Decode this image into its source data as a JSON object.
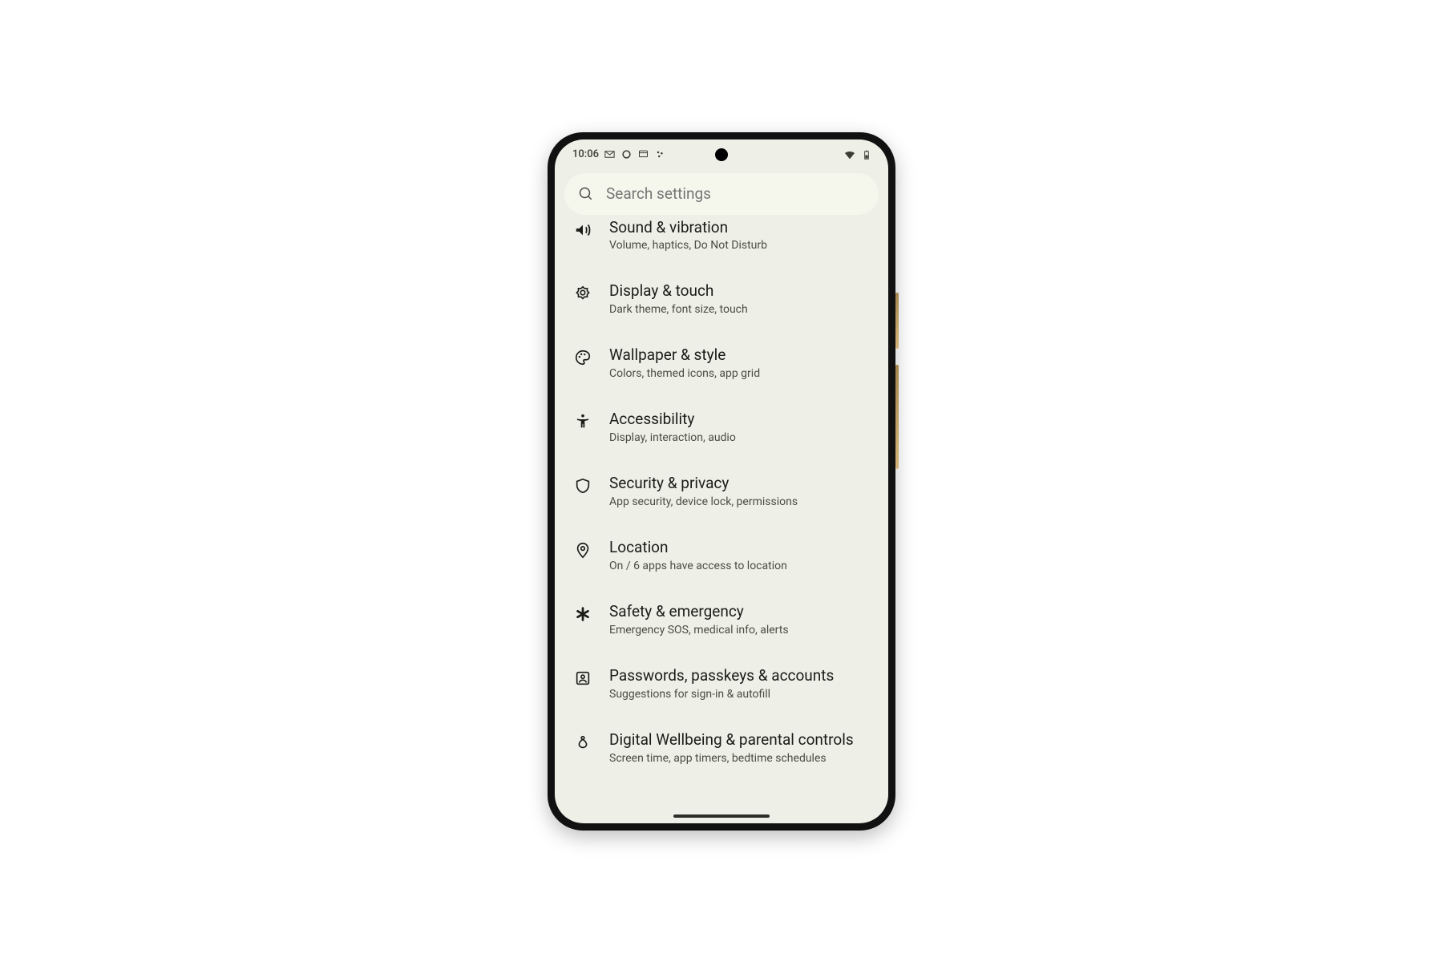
{
  "status": {
    "time": "10:06",
    "left_icons": [
      "gmail",
      "circle",
      "chat",
      "dots"
    ],
    "right_icons": [
      "wifi",
      "battery"
    ]
  },
  "search": {
    "placeholder": "Search settings"
  },
  "settings": [
    {
      "id": "sound",
      "icon": "volume-icon",
      "title": "Sound & vibration",
      "subtitle": "Volume, haptics, Do Not Disturb"
    },
    {
      "id": "display",
      "icon": "brightness-icon",
      "title": "Display & touch",
      "subtitle": "Dark theme, font size, touch"
    },
    {
      "id": "wallpaper",
      "icon": "palette-icon",
      "title": "Wallpaper & style",
      "subtitle": "Colors, themed icons, app grid"
    },
    {
      "id": "accessibility",
      "icon": "accessibility-icon",
      "title": "Accessibility",
      "subtitle": "Display, interaction, audio"
    },
    {
      "id": "security",
      "icon": "shield-icon",
      "title": "Security & privacy",
      "subtitle": "App security, device lock, permissions"
    },
    {
      "id": "location",
      "icon": "location-icon",
      "title": "Location",
      "subtitle": "On / 6 apps have access to location"
    },
    {
      "id": "safety",
      "icon": "asterisk-icon",
      "title": "Safety & emergency",
      "subtitle": "Emergency SOS, medical info, alerts"
    },
    {
      "id": "passwords",
      "icon": "account-box-icon",
      "title": "Passwords, passkeys & accounts",
      "subtitle": "Suggestions for sign-in & autofill"
    },
    {
      "id": "wellbeing",
      "icon": "wellbeing-icon",
      "title": "Digital Wellbeing & parental controls",
      "subtitle": "Screen time, app timers, bedtime schedules"
    }
  ]
}
